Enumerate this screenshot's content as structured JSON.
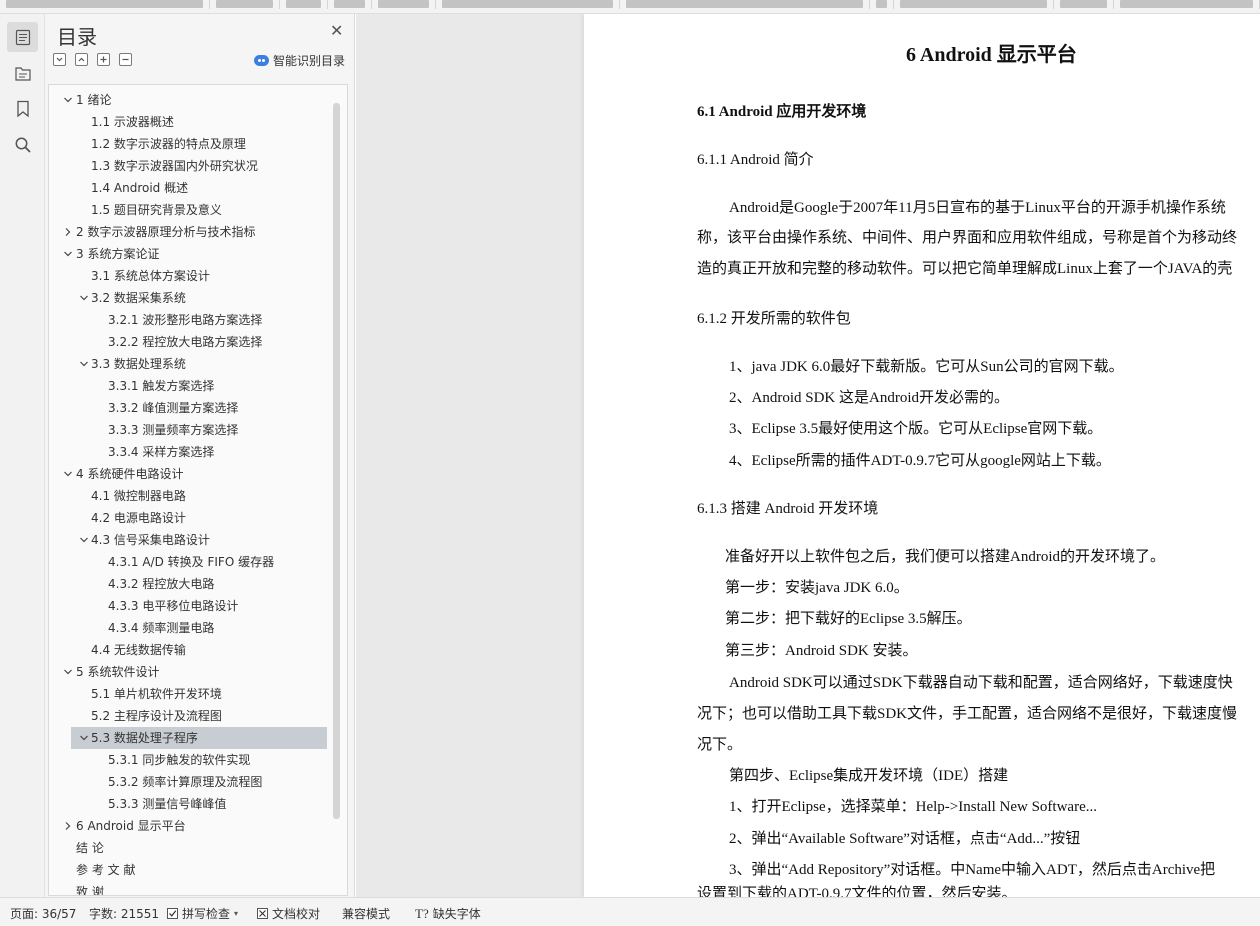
{
  "toc_panel": {
    "title": "目录",
    "smart_label": "智能识别目录",
    "items": [
      {
        "label": "1  绪论",
        "level": 1,
        "toggle": "open"
      },
      {
        "label": "1.1  示波器概述",
        "level": 2,
        "toggle": "none"
      },
      {
        "label": "1.2  数字示波器的特点及原理",
        "level": 2,
        "toggle": "none"
      },
      {
        "label": "1.3  数字示波器国内外研究状况",
        "level": 2,
        "toggle": "none"
      },
      {
        "label": "1.4 Android 概述",
        "level": 2,
        "toggle": "none"
      },
      {
        "label": "1.5  题目研究背景及意义",
        "level": 2,
        "toggle": "none"
      },
      {
        "label": "2  数字示波器原理分析与技术指标",
        "level": 1,
        "toggle": "closed"
      },
      {
        "label": "3  系统方案论证",
        "level": 1,
        "toggle": "open"
      },
      {
        "label": "3.1  系统总体方案设计",
        "level": 2,
        "toggle": "none"
      },
      {
        "label": "3.2  数据采集系统",
        "level": 2,
        "toggle": "open"
      },
      {
        "label": "3.2.1  波形整形电路方案选择",
        "level": 3,
        "toggle": "none"
      },
      {
        "label": "3.2.2  程控放大电路方案选择",
        "level": 3,
        "toggle": "none"
      },
      {
        "label": "3.3  数据处理系统",
        "level": 2,
        "toggle": "open"
      },
      {
        "label": "3.3.1  触发方案选择",
        "level": 3,
        "toggle": "none"
      },
      {
        "label": "3.3.2  峰值测量方案选择",
        "level": 3,
        "toggle": "none"
      },
      {
        "label": "3.3.3  测量频率方案选择",
        "level": 3,
        "toggle": "none"
      },
      {
        "label": "3.3.4  采样方案选择",
        "level": 3,
        "toggle": "none"
      },
      {
        "label": "4  系统硬件电路设计",
        "level": 1,
        "toggle": "open"
      },
      {
        "label": "4.1  微控制器电路",
        "level": 2,
        "toggle": "none"
      },
      {
        "label": "4.2  电源电路设计",
        "level": 2,
        "toggle": "none"
      },
      {
        "label": "4.3  信号采集电路设计",
        "level": 2,
        "toggle": "open"
      },
      {
        "label": "4.3.1 A/D 转换及 FIFO 缓存器",
        "level": 3,
        "toggle": "none"
      },
      {
        "label": "4.3.2  程控放大电路",
        "level": 3,
        "toggle": "none"
      },
      {
        "label": "4.3.3  电平移位电路设计",
        "level": 3,
        "toggle": "none"
      },
      {
        "label": "4.3.4  频率测量电路",
        "level": 3,
        "toggle": "none"
      },
      {
        "label": "4.4  无线数据传输",
        "level": 2,
        "toggle": "none"
      },
      {
        "label": "5  系统软件设计",
        "level": 1,
        "toggle": "open"
      },
      {
        "label": "5.1  单片机软件开发环境",
        "level": 2,
        "toggle": "none"
      },
      {
        "label": "5.2  主程序设计及流程图",
        "level": 2,
        "toggle": "none"
      },
      {
        "label": "5.3  数据处理子程序",
        "level": 2,
        "toggle": "open",
        "selected": true
      },
      {
        "label": "5.3.1  同步触发的软件实现",
        "level": 3,
        "toggle": "none"
      },
      {
        "label": "5.3.2  频率计算原理及流程图",
        "level": 3,
        "toggle": "none"
      },
      {
        "label": "5.3.3  测量信号峰峰值",
        "level": 3,
        "toggle": "none"
      },
      {
        "label": "6 Android 显示平台",
        "level": 1,
        "toggle": "closed"
      },
      {
        "label": "结   论",
        "level": 1,
        "toggle": "none"
      },
      {
        "label": "参   考   文   献",
        "level": 1,
        "toggle": "none"
      },
      {
        "label": "致   谢",
        "level": 1,
        "toggle": "none"
      }
    ]
  },
  "document": {
    "lines": [
      {
        "text": "6 Android 显示平台",
        "style": "h1"
      },
      {
        "text": "6.1 Android 应用开发环境",
        "style": "h2"
      },
      {
        "text": "6.1.1 Android 简介",
        "style": "p"
      },
      {
        "text": "Android是Google于2007年11月5日宣布的基于Linux平台的开源手机操作系统",
        "style": "p"
      },
      {
        "text": "称，该平台由操作系统、中间件、用户界面和应用软件组成，号称是首个为移动终",
        "style": "p"
      },
      {
        "text": "造的真正开放和完整的移动软件。可以把它简单理解成Linux上套了一个JAVA的壳",
        "style": "p"
      },
      {
        "text": "6.1.2  开发所需的软件包",
        "style": "p"
      },
      {
        "text": "1、java JDK 6.0最好下载新版。它可从Sun公司的官网下载。",
        "style": "p"
      },
      {
        "text": "2、Android SDK  这是Android开发必需的。",
        "style": "p"
      },
      {
        "text": "3、Eclipse 3.5最好使用这个版。它可从Eclipse官网下载。",
        "style": "p"
      },
      {
        "text": "4、Eclipse所需的插件ADT-0.9.7它可从google网站上下载。",
        "style": "p"
      },
      {
        "text": "6.1.3  搭建 Android 开发环境",
        "style": "p"
      },
      {
        "text": "准备好开以上软件包之后，我们便可以搭建Android的开发环境了。",
        "style": "p"
      },
      {
        "text": "第一步：安装java JDK 6.0。",
        "style": "p"
      },
      {
        "text": "第二步：把下载好的Eclipse 3.5解压。",
        "style": "p"
      },
      {
        "text": "第三步：Android SDK  安装。",
        "style": "p"
      },
      {
        "text": "Android SDK可以通过SDK下载器自动下载和配置，适合网络好，下载速度快",
        "style": "p"
      },
      {
        "text": "况下；也可以借助工具下载SDK文件，手工配置，适合网络不是很好，下载速度慢",
        "style": "p"
      },
      {
        "text": "况下。",
        "style": "p"
      },
      {
        "text": "第四步、Eclipse集成开发环境（IDE）搭建",
        "style": "p"
      },
      {
        "text": "1、打开Eclipse，选择菜单：Help->Install New Software...",
        "style": "p"
      },
      {
        "text": "2、弹出“Available Software”对话框，点击“Add...”按钮",
        "style": "p"
      },
      {
        "text": "3、弹出“Add Repository”对话框。中Name中输入ADT，然后点击Archive把",
        "style": "p"
      },
      {
        "text": "设置到下载的ADT-0.9.7文件的位置，然后安装。",
        "style": "p"
      }
    ]
  },
  "status_bar": {
    "page": "页面: 36/57",
    "words": "字数: 21551",
    "spell_check": "拼写检查",
    "proofread": "文档校对",
    "compat_mode": "兼容模式",
    "missing_fonts": "缺失字体"
  },
  "icons": [
    "toc-icon",
    "outline-icon",
    "bookmark-icon",
    "search-icon",
    "close-icon",
    "collapse-all-icon",
    "expand-icon",
    "add-item-icon",
    "remove-item-icon",
    "smart-toc-icon",
    "dropdown-arrow-icon",
    "proofread-icon",
    "missing-font-icon"
  ],
  "colors": {
    "selected_row": "#c8ccd3",
    "smart_icon": "#3d7fe0"
  }
}
